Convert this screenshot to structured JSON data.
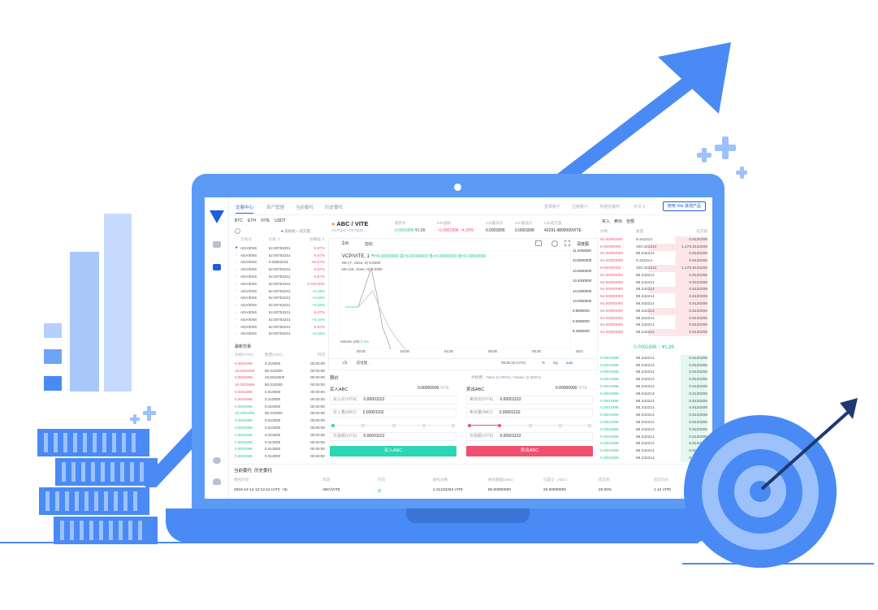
{
  "colors": {
    "accent": "#1c5fdc",
    "laptop": "#5b9bf6",
    "buy": "#2ad6b4",
    "sell": "#f0506e"
  },
  "nav": {
    "tabs": [
      "交易中心",
      "资产管理",
      "当前委托",
      "历史委托"
    ],
    "right": [
      "登录账户",
      "注册账户",
      "开通交易所",
      "中文 ▾"
    ],
    "use_btn": "使用 Vite 其他产品"
  },
  "markets": {
    "tabs": [
      "BTC",
      "ETH",
      "VITE",
      "USDT"
    ],
    "radio1": "涨跌幅",
    "radio2": "成交量",
    "headers": [
      "交易对",
      "价格 ⇕",
      "涨跌幅 ⇕"
    ],
    "rows": [
      [
        "ADA/ENS",
        "62.00753231",
        "-5.87%",
        "red"
      ],
      [
        "ADA/ENS",
        "62.00753231",
        "-5.87%",
        "red"
      ],
      [
        "ADA/ENS",
        "0.00653231",
        "-50.87%",
        "red"
      ],
      [
        "ADA/ENS",
        "62.00753231",
        "-5.87%",
        "red"
      ],
      [
        "ADA/ENS",
        "62.00753231",
        "-5.87%",
        "red"
      ],
      [
        "ADA/ENS",
        "62.00753231",
        "3,700.00%",
        "red"
      ],
      [
        "ADA/ENS",
        "62.00753231",
        "+0.16%",
        "green"
      ],
      [
        "ADA/ENS",
        "62.00753231",
        "+0.16%",
        "green"
      ],
      [
        "ADA/ENS",
        "62.00753231",
        "+0.16%",
        "green"
      ],
      [
        "ADA/ENS",
        "62.00753231",
        "-5.87%",
        "red"
      ],
      [
        "ADA/ENS",
        "62.00753231",
        "+0.16%",
        "green"
      ],
      [
        "ADA/ENS",
        "62.00753231",
        "-5.87%",
        "red"
      ],
      [
        "ADA/ENS",
        "62.00753231",
        "+0.16%",
        "green"
      ]
    ]
  },
  "trades": {
    "title": "最新交易",
    "headers": [
      "价格(VITE)",
      "数量(ABC)",
      "时间"
    ],
    "rows": [
      [
        "0.0001896",
        "0.210000",
        "00:00:00",
        "red"
      ],
      [
        "19.0001896",
        "80.010000",
        "00:00:00",
        "red"
      ],
      [
        "0.0001896",
        "23.6010000",
        "00:00:00",
        "red"
      ],
      [
        "10.0001896",
        "80.010000",
        "00:00:00",
        "red"
      ],
      [
        "0.0001896",
        "0.010000",
        "00:00:00",
        "red"
      ],
      [
        "0.0001896",
        "0.210000",
        "00:00:00",
        "red"
      ],
      [
        "0.0001896",
        "0.010000",
        "00:00:00",
        "green"
      ],
      [
        "10.0001896",
        "80.010000",
        "00:00:00",
        "green"
      ],
      [
        "0.0001896",
        "0.013000",
        "00:00:00",
        "green"
      ],
      [
        "0.0001896",
        "0.013000",
        "00:00:00",
        "green"
      ],
      [
        "0.0001896",
        "0.013000",
        "00:00:00",
        "green"
      ],
      [
        "0.0001896",
        "0.013000",
        "00:00:00",
        "green"
      ],
      [
        "0.0001896",
        "0.013000",
        "00:00:00",
        "green"
      ],
      [
        "0.0001896",
        "0.013000",
        "00:00:00",
        "green"
      ]
    ]
  },
  "ticker": {
    "pair": "ABC / VITE",
    "sub": "ATATgJ5 / ATATgJ5",
    "price_label": "最新价",
    "price": "0.0001896",
    "price_vite": "¥1.89",
    "chg_label": "24h涨跌",
    "chg": "−0.0001896 −4.20%",
    "high_label": "24h最高价",
    "high": "0.0001896",
    "low_label": "24h最低价",
    "low": "0.0001896",
    "vol_label": "24h成交量",
    "vol": "42291.4800000VITE"
  },
  "chart": {
    "interval": "1m",
    "indicator": "指标",
    "depth": "深度图",
    "legend": "VCP/VITE, 1",
    "ohlc": "开=9.00000000 高=9.00000000 低=9.00000000 收=9.00000000",
    "ma1": "MA (7, close, 0)",
    "ma1v": "9.0000",
    "ma2": "MA (15, close, 0)",
    "ma2v": "9.0000",
    "volume": "Volume (20)",
    "volv": "0 n/a",
    "yticks": [
      "11.2000000",
      "10.8000000",
      "10.6000000",
      "10.4000000",
      "10.2000000",
      "10.0000000",
      "9.8000000",
      "9.6000000",
      "9.4000000"
    ],
    "xticks": [
      "00:00",
      "04:00",
      "04:30",
      "06:00",
      "00:30",
      "06:0"
    ],
    "footer_left": "1天",
    "footer_mid": "前往图...",
    "footer_time": "09:26:15 (UTC)",
    "footer_pct": "%",
    "footer_log": "log",
    "footer_auto": "auto"
  },
  "orderbook": {
    "tabs": [
      "买入",
      "卖出",
      "全部"
    ],
    "headers": [
      "价格",
      "数量",
      "成交额"
    ],
    "asks": [
      [
        "54.00000000",
        "9.342214",
        "0.8120206"
      ],
      [
        "9.00000000",
        "100.342214",
        "1,176.8120206"
      ],
      [
        "54.00000000",
        "88.342214",
        "0.8120206"
      ],
      [
        "54.00000000",
        "9.342214",
        "0.8120206"
      ],
      [
        "9.00000000",
        "100.342214",
        "1,176.8120206"
      ],
      [
        "54.00000000",
        "88.342214",
        "0.8120206"
      ],
      [
        "54.00000000",
        "88.342214",
        "0.8120206"
      ],
      [
        "54.00000000",
        "88.342214",
        "0.8120206"
      ],
      [
        "54.00000000",
        "88.342214",
        "0.8120206"
      ],
      [
        "54.00000000",
        "88.342214",
        "0.8120206"
      ],
      [
        "54.00000000",
        "88.342214",
        "0.8120206"
      ],
      [
        "54.00000000",
        "88.342214",
        "0.8120206"
      ],
      [
        "54.00000000",
        "88.342214",
        "0.8120206"
      ],
      [
        "54.00000000",
        "88.342214",
        "0.8120206"
      ]
    ],
    "mid": "0.0001896 ↑ ¥1.89",
    "bids": [
      [
        "0.0001896",
        "88.342214",
        "0.8120206"
      ],
      [
        "0.0001896",
        "88.342214",
        "0.8120206"
      ],
      [
        "0.0001896",
        "88.342214",
        "0.8120206"
      ],
      [
        "0.0001896",
        "88.342214",
        "0.8120206"
      ],
      [
        "0.0001896",
        "88.342214",
        "0.8120206"
      ],
      [
        "0.0001896",
        "88.342214",
        "0.8120206"
      ],
      [
        "0.0001896",
        "88.342214",
        "0.8120206"
      ],
      [
        "0.0001896",
        "88.342214",
        "0.8120206"
      ],
      [
        "0.0001896",
        "88.342214",
        "0.8120206"
      ],
      [
        "0.0001896",
        "88.342214",
        "0.8120206"
      ],
      [
        "0.0001896",
        "88.342214",
        "0.8120206"
      ],
      [
        "0.0001896",
        "88.342214",
        "0.8120206"
      ],
      [
        "0.0001896",
        "88.342214",
        "0.8120206"
      ],
      [
        "0.0001896",
        "88.342214",
        "0.8120206"
      ],
      [
        "0.0001896",
        "88.342214",
        "0.8120206"
      ]
    ]
  },
  "order": {
    "title": "限价",
    "fee": "手续费：Taker (0.000%) / Maker (0.000%)",
    "buy": {
      "title": "买入ABC",
      "balance": "0.00000000",
      "unit": "VITE",
      "price_label": "买入价(VITE)",
      "price": "0.00001152",
      "qty_label": "买入量(ABC)",
      "qty": "0.00001152",
      "total_label": "交易额(VITE)",
      "total": "0.00001152",
      "btn": "买入ABC"
    },
    "sell": {
      "title": "卖出ABC",
      "balance": "0.00000000",
      "unit": "VITE",
      "price_label": "卖出价(VITE)",
      "price": "0.00001152",
      "qty_label": "卖出量(ABC)",
      "qty": "0.00001152",
      "total_label": "交易额(VITE)",
      "total": "0.00001152",
      "btn": "卖出ABC"
    }
  },
  "orders": {
    "tabs": [
      "当前委托",
      "历史委托"
    ],
    "headers": [
      "委托时间",
      "市场",
      "方向",
      "委托价格",
      "委托数量(ABC)",
      "已成交（ABC）",
      "成交率",
      "成交均价"
    ],
    "row": [
      "2018-12-14 12:12:12 (UTC +8)",
      "ABC/VITE",
      "买",
      "1.21233334 VITE",
      "50.00000000",
      "20.00000000",
      "20.00%",
      "1.12 VITE"
    ]
  }
}
